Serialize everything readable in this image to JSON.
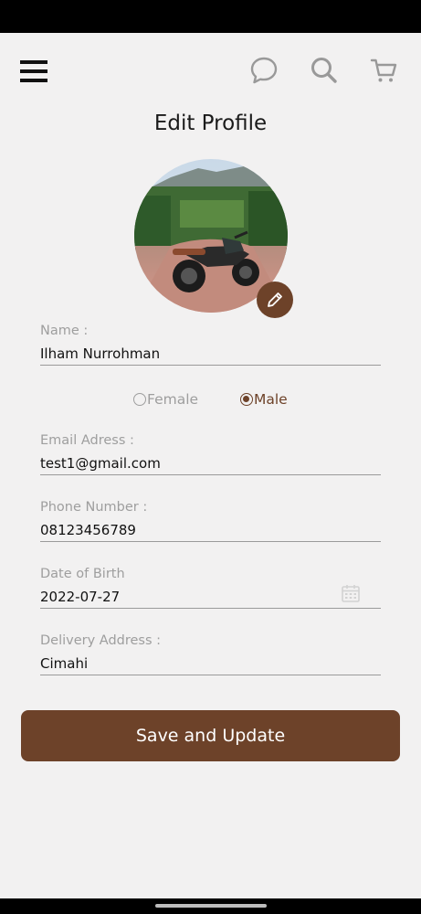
{
  "header": {
    "menu_icon": "hamburger-menu-icon",
    "chat_icon": "chat-bubble-icon",
    "search_icon": "search-icon",
    "cart_icon": "shopping-cart-icon"
  },
  "page_title": "Edit Profile",
  "form": {
    "name": {
      "label": "Name :",
      "value": "Ilham Nurrohman"
    },
    "gender": {
      "options": [
        "Female",
        "Male"
      ],
      "selected": "Male"
    },
    "email": {
      "label": "Email Adress :",
      "value": "test1@gmail.com"
    },
    "phone": {
      "label": "Phone Number :",
      "value": "08123456789"
    },
    "dob": {
      "label": "Date of Birth",
      "value": "2022-07-27"
    },
    "address": {
      "label": "Delivery Address :",
      "value": "Cimahi"
    }
  },
  "save_button": "Save and Update",
  "colors": {
    "brand": "#6d4229",
    "background": "#f2f1f1",
    "muted": "#9e9e9e"
  }
}
